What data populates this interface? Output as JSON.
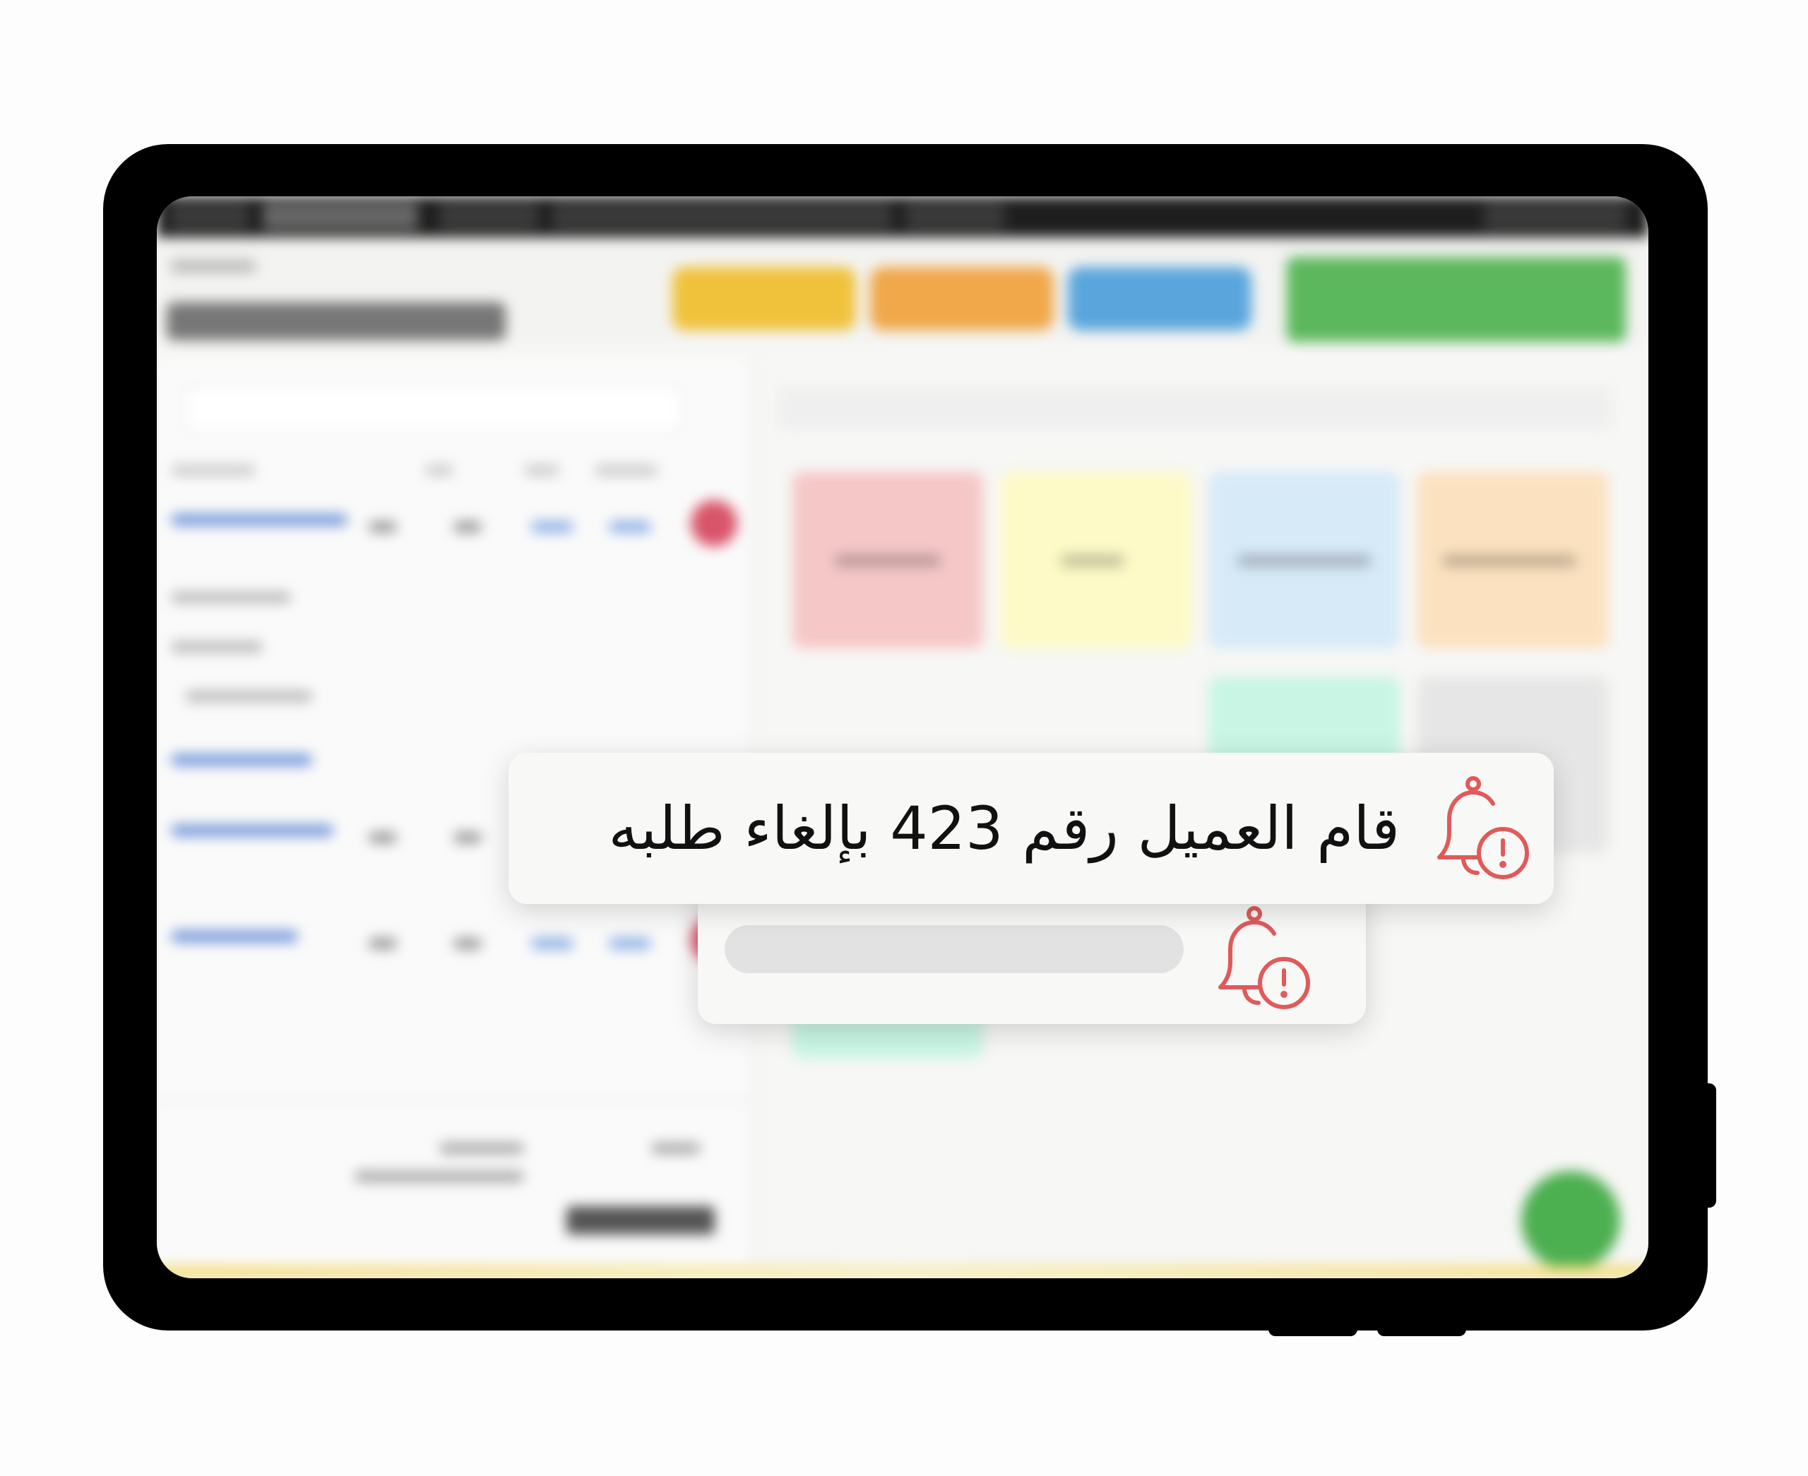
{
  "notification": {
    "message": "قام العميل رقم 423 بإلغاء طلبه",
    "icon": "bell-alert-icon",
    "icon_color": "#e05a5a"
  },
  "notification_secondary": {
    "icon": "bell-alert-icon",
    "icon_color": "#e05a5a"
  },
  "colors": {
    "tile_red": "#f5c7c7",
    "tile_yellow": "#fdfac7",
    "tile_blue": "#d6eaf8",
    "tile_orange": "#fbe1bf",
    "tile_mint": "#c8f5e4",
    "tile_gray": "#e6e6e6",
    "btn_yellow": "#f0c23c",
    "btn_orange": "#f0a84a",
    "btn_blue": "#5aa6dc",
    "btn_green": "#5cb85c"
  }
}
